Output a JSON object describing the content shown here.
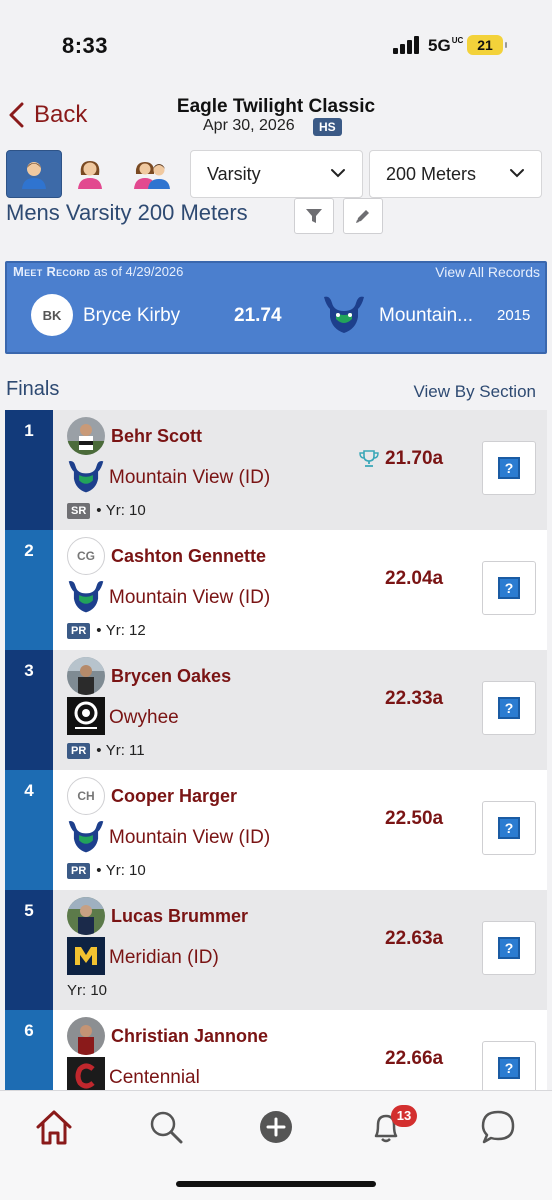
{
  "status_bar": {
    "time": "8:33",
    "network": "5G",
    "network_sub": "UC",
    "battery": "21"
  },
  "header": {
    "back_label": "Back",
    "meet_title": "Eagle Twilight Classic",
    "meet_date": "Apr 30, 2026",
    "level_badge": "HS"
  },
  "filters": {
    "level": "Varsity",
    "event": "200 Meters",
    "active_gender": "male"
  },
  "event_title": "Mens Varsity 200 Meters",
  "meet_record": {
    "label": "Meet Record",
    "as_of": "as of 4/29/2026",
    "view_all": "View All Records",
    "initials": "BK",
    "athlete": "Bryce Kirby",
    "mark": "21.74",
    "team": "Mountain...",
    "year": "2015"
  },
  "section_title": "Finals",
  "view_by_section": "View By Section",
  "results": [
    {
      "place": "1",
      "name": "Behr Scott",
      "team": "Mountain View (ID)",
      "team_logo": "mountain-view",
      "badge": "SR",
      "year": "Yr: 10",
      "time": "21.70a",
      "photo": true,
      "trophy": true
    },
    {
      "place": "2",
      "name": "Cashton Gennette",
      "initials": "CG",
      "team": "Mountain View (ID)",
      "team_logo": "mountain-view",
      "badge": "PR",
      "year": "Yr: 12",
      "time": "22.04a",
      "photo": false
    },
    {
      "place": "3",
      "name": "Brycen Oakes",
      "team": "Owyhee",
      "team_logo": "owyhee",
      "badge": "PR",
      "year": "Yr: 11",
      "time": "22.33a",
      "photo": true
    },
    {
      "place": "4",
      "name": "Cooper Harger",
      "initials": "CH",
      "team": "Mountain View (ID)",
      "team_logo": "mountain-view",
      "badge": "PR",
      "year": "Yr: 10",
      "time": "22.50a",
      "photo": false
    },
    {
      "place": "5",
      "name": "Lucas Brummer",
      "team": "Meridian (ID)",
      "team_logo": "meridian",
      "badge": "",
      "year": "Yr: 10",
      "time": "22.63a",
      "photo": true
    },
    {
      "place": "6",
      "name": "Christian Jannone",
      "team": "Centennial",
      "team_logo": "centennial",
      "badge": "",
      "year": "",
      "time": "22.66a",
      "photo": true
    }
  ],
  "tabbar": {
    "notifications": "13"
  },
  "colors": {
    "accent_blue": "#3d6aa8",
    "maroon": "#7a1414",
    "record_blue": "#4b7fce"
  }
}
